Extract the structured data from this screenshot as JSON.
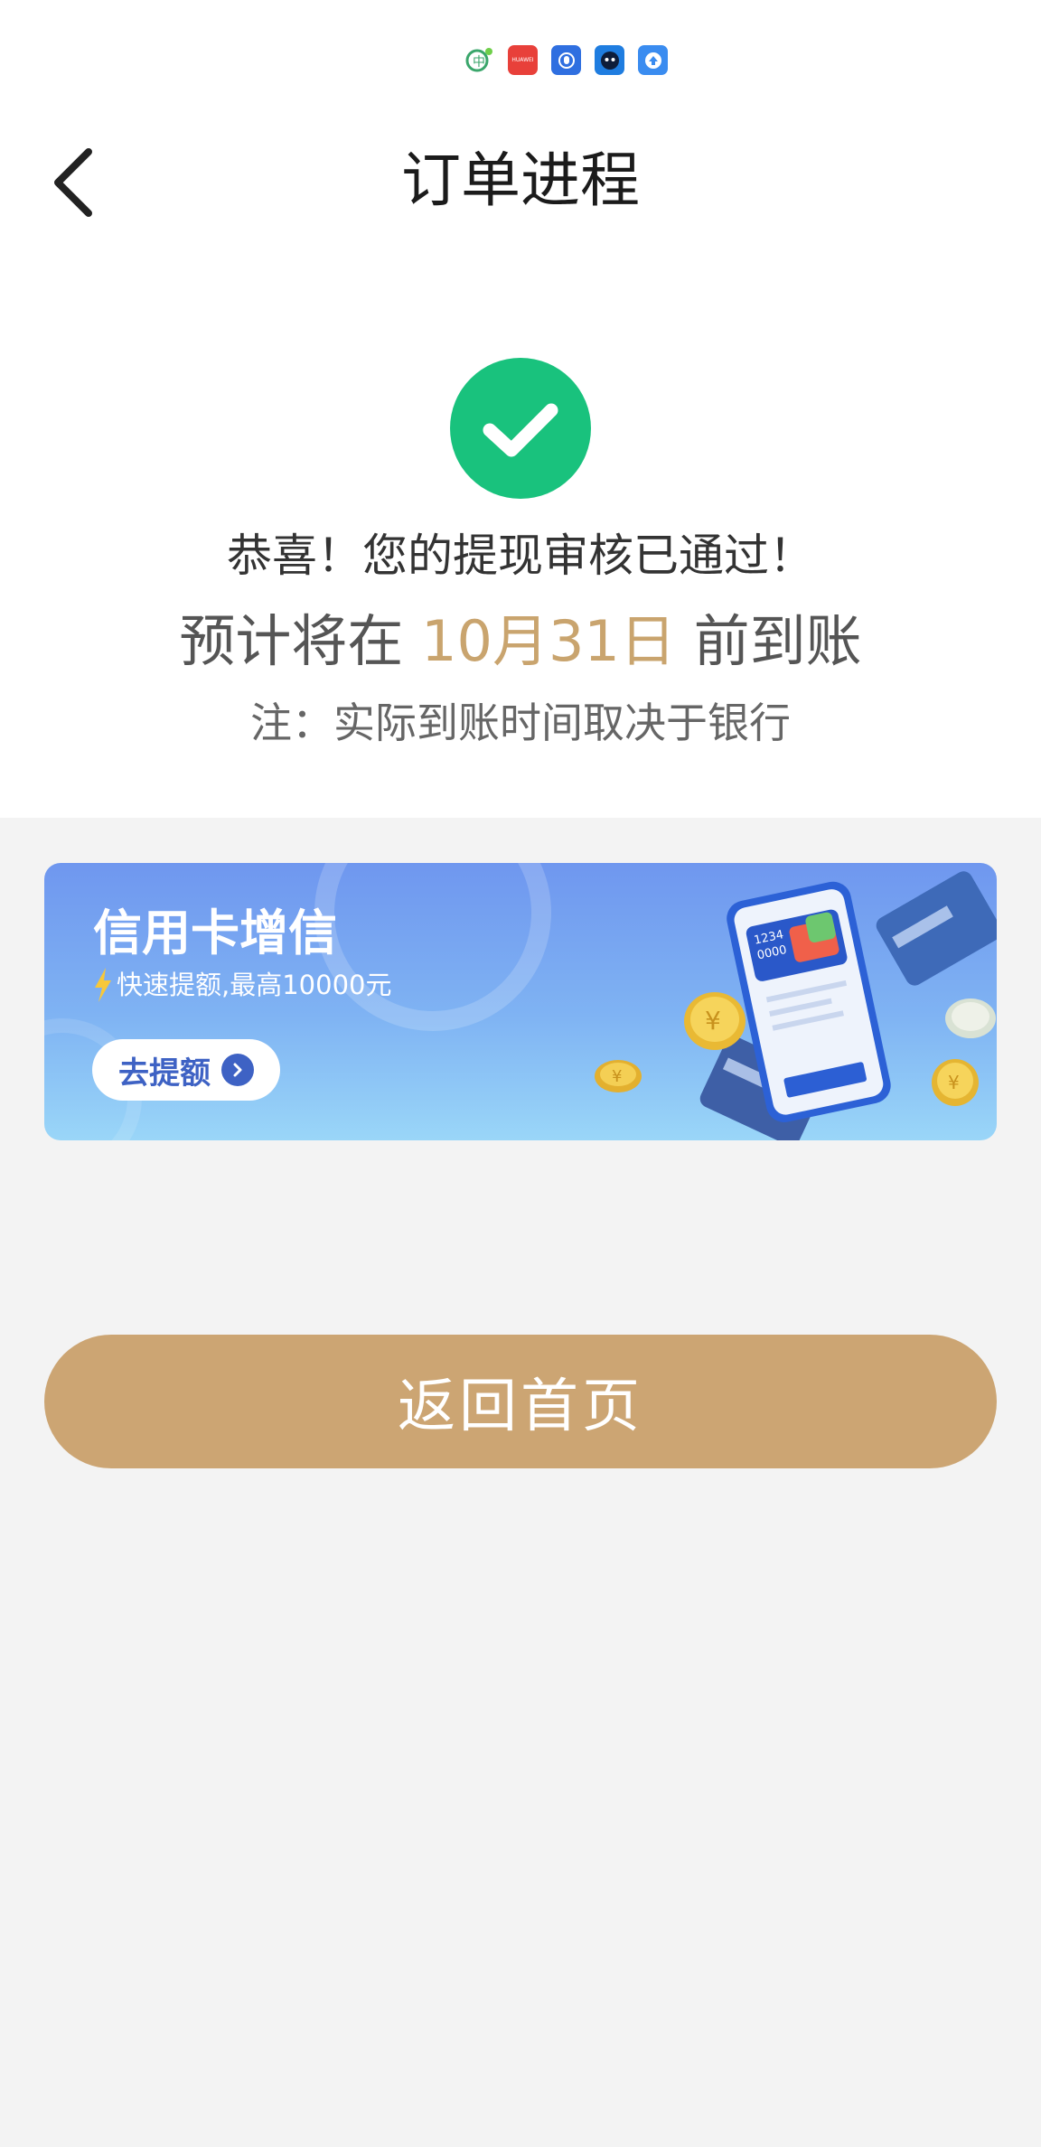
{
  "status_bar": {
    "icons": [
      "app-icon-green",
      "huawei-store-icon",
      "hand-app-icon",
      "robot-app-icon",
      "upload-app-icon"
    ],
    "huawei_label": "HUAWEI"
  },
  "header": {
    "title": "订单进程",
    "back_icon": "chevron-left-icon"
  },
  "result": {
    "icon": "check-circle-icon",
    "icon_color": "#19c27d",
    "message": "恭喜！您的提现审核已通过！",
    "eta_prefix": "预计将在",
    "eta_date": "10月31日",
    "eta_suffix": "前到账",
    "note": "注：实际到账时间取决于银行",
    "accent_color": "#c9a46e"
  },
  "banner": {
    "title": "信用卡增信",
    "subtitle": "快速提额,最高10000元",
    "button_label": "去提额",
    "card_number_top": "1234",
    "card_number_bottom": "0000",
    "coin_symbol": "¥"
  },
  "actions": {
    "home_button_label": "返回首页",
    "button_color": "#cca573"
  }
}
